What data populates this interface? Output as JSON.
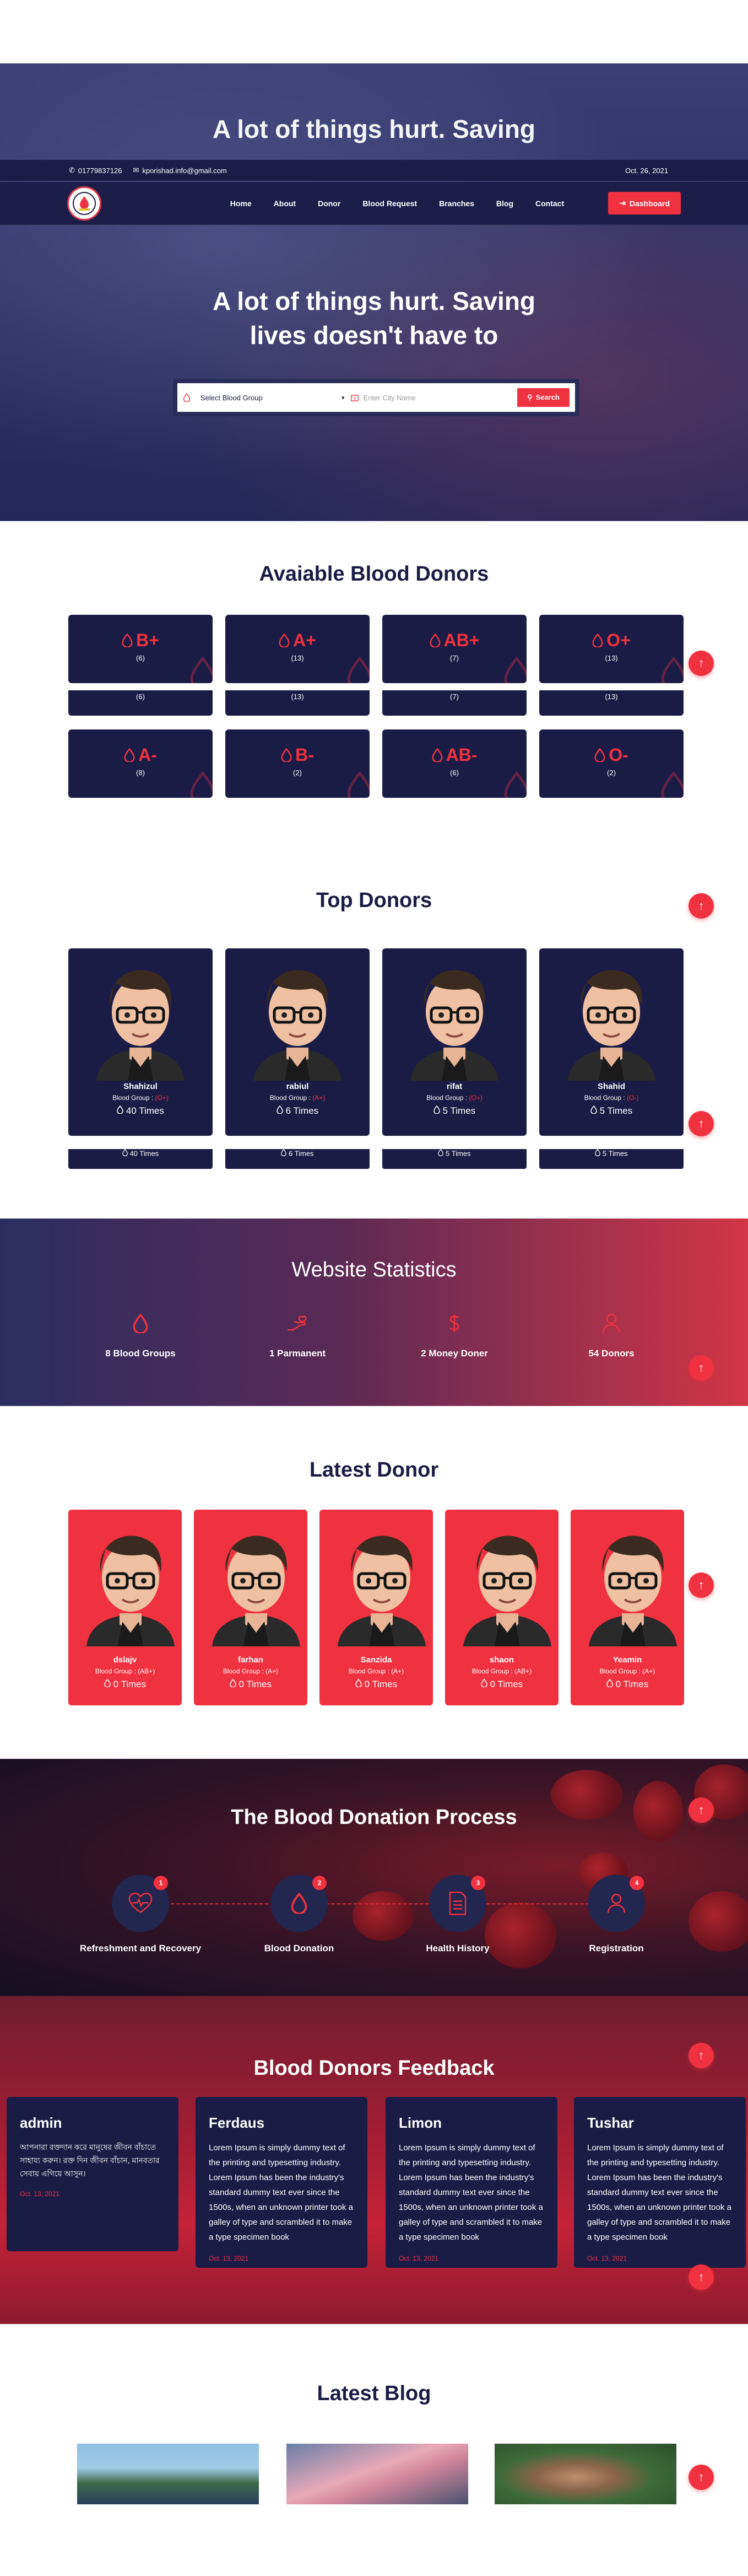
{
  "topbar": {
    "phone": "01779837126",
    "email": "kporishad.info@gmail.com",
    "date": "Oct. 26, 2021"
  },
  "nav": {
    "items": [
      "Home",
      "About",
      "Donor",
      "Blood Request",
      "Branches",
      "Blog",
      "Contact"
    ],
    "dashboard": "Dashboard"
  },
  "hero": {
    "title_line1": "A lot of things hurt. Saving",
    "title_line2": "lives doesn't have to",
    "select_placeholder": "Select Blood Group",
    "city_placeholder": "Enter City Name",
    "search_label": "Search"
  },
  "available": {
    "title": "Avaiable Blood Donors",
    "groups": [
      {
        "group": "B+",
        "count": "(6)"
      },
      {
        "group": "A+",
        "count": "(13)"
      },
      {
        "group": "AB+",
        "count": "(7)"
      },
      {
        "group": "O+",
        "count": "(13)"
      },
      {
        "group": "A-",
        "count": "(8)"
      },
      {
        "group": "B-",
        "count": "(2)"
      },
      {
        "group": "AB-",
        "count": "(6)"
      },
      {
        "group": "O-",
        "count": "(2)"
      }
    ]
  },
  "top_donors": {
    "title": "Top Donors",
    "donors": [
      {
        "name": "Shahizul",
        "group_label": "Blood Group :",
        "group": "(O+)",
        "times": "40 Times"
      },
      {
        "name": "rabiul",
        "group_label": "Blood Group :",
        "group": "(A+)",
        "times": "6 Times"
      },
      {
        "name": "rifat",
        "group_label": "Blood Group :",
        "group": "(O+)",
        "times": "5 Times"
      },
      {
        "name": "Shahid",
        "group_label": "Blood Group :",
        "group": "(O-)",
        "times": "5 Times"
      }
    ]
  },
  "stats": {
    "title": "Website Statistics",
    "items": [
      {
        "label": "8 Blood Groups"
      },
      {
        "label": "1 Parmanent"
      },
      {
        "label": "2 Money Doner"
      },
      {
        "label": "54 Donors"
      }
    ]
  },
  "latest_donor": {
    "title": "Latest Donor",
    "donors": [
      {
        "name": "dslajv",
        "group": "Blood Group : (AB+)",
        "times": "0 Times"
      },
      {
        "name": "farhan",
        "group": "Blood Group : (A+)",
        "times": "0 Times"
      },
      {
        "name": "Sanzida",
        "group": "Blood Group : (A+)",
        "times": "0 Times"
      },
      {
        "name": "shaon",
        "group": "Blood Group : (AB+)",
        "times": "0 Times"
      },
      {
        "name": "Yeamin",
        "group": "Blood Group : (A+)",
        "times": "0 Times"
      }
    ]
  },
  "process": {
    "title": "The Blood Donation Process",
    "steps": [
      {
        "num": "1",
        "label": "Refreshment and Recovery"
      },
      {
        "num": "2",
        "label": "Blood Donation"
      },
      {
        "num": "3",
        "label": "Health History"
      },
      {
        "num": "4",
        "label": "Registration"
      }
    ]
  },
  "feedback": {
    "title": "Blood Donors Feedback",
    "items": [
      {
        "name": "admin",
        "text": "আপনারা রক্তদান করে মানুষের জীবন বাঁচাতে সাহায্য করুন। রক্ত দিন জীবন বাঁচান, মানবতার সেবায় এগিয়ে আসুন।",
        "date": "Oct. 13, 2021"
      },
      {
        "name": "Ferdaus",
        "text": "Lorem Ipsum is simply dummy text of the printing and typesetting industry. Lorem Ipsum has been the industry's standard dummy text ever since the 1500s, when an unknown printer took a galley of type and scrambled it to make a type specimen book",
        "date": "Oct. 13, 2021"
      },
      {
        "name": "Limon",
        "text": "Lorem Ipsum is simply dummy text of the printing and typesetting industry. Lorem Ipsum has been the industry's standard dummy text ever since the 1500s, when an unknown printer took a galley of type and scrambled it to make a type specimen book",
        "date": "Oct. 13, 2021"
      },
      {
        "name": "Tushar",
        "text": "Lorem Ipsum is simply dummy text of the printing and typesetting industry. Lorem Ipsum has been the industry's standard dummy text ever since the 1500s, when an unknown printer took a galley of type and scrambled it to make a type specimen book",
        "date": "Oct. 13, 2021"
      }
    ]
  },
  "blog": {
    "title": "Latest Blog"
  },
  "colors": {
    "accent": "#f0313f",
    "navy": "#1b1c45"
  },
  "icons": {
    "scroll_top": "arrow-up-icon",
    "drop": "blood-drop-icon"
  }
}
